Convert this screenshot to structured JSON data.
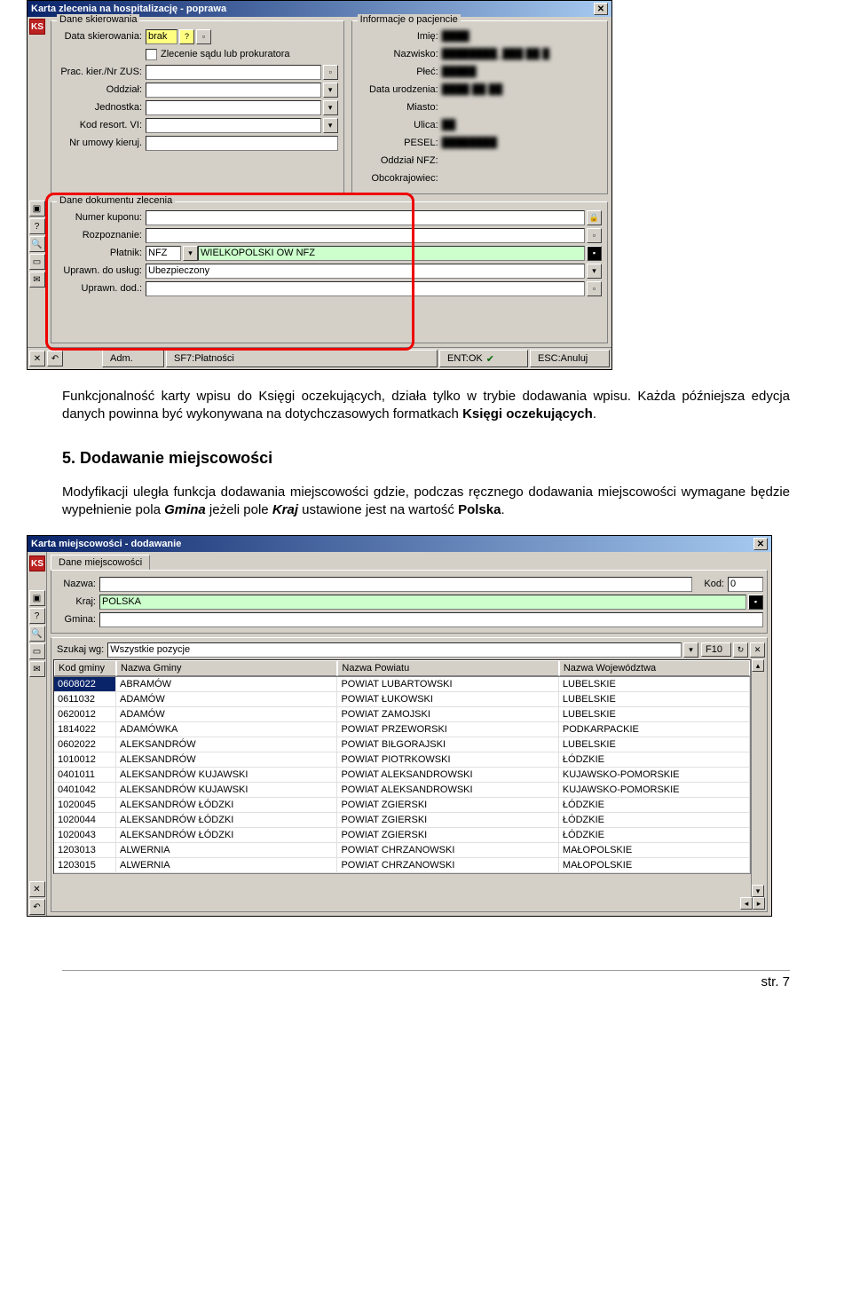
{
  "window1": {
    "title": "Karta zlecenia na hospitalizację - poprawa",
    "group_referral": "Dane skierowania",
    "group_patient": "Informacje o pacjencie",
    "ref": {
      "data_label": "Data skierowania:",
      "data_value": "brak",
      "zlecenie_checkbox_label": "Zlecenie sądu lub prokuratora",
      "prac_label": "Prac. kier./Nr ZUS:",
      "oddzial_label": "Oddział:",
      "jednostka_label": "Jednostka:",
      "kod_label": "Kod resort. VI:",
      "nr_umowy_label": "Nr umowy kieruj."
    },
    "patient": {
      "imie_label": "Imię:",
      "nazwisko_label": "Nazwisko:",
      "plec_label": "Płeć:",
      "data_ur_label": "Data urodzenia:",
      "miasto_label": "Miasto:",
      "ulica_label": "Ulica:",
      "pesel_label": "PESEL:",
      "nfz_label": "Oddział NFZ:",
      "obco_label": "Obcokrajowiec:"
    },
    "group_doc": "Dane dokumentu zlecenia",
    "doc": {
      "kupon_label": "Numer kuponu:",
      "rozpoznanie_label": "Rozpoznanie:",
      "platnik_label": "Płatnik:",
      "platnik_code": "NFZ",
      "platnik_value": "WIELKOPOLSKI OW NFZ",
      "uprawn_label": "Uprawn. do usług:",
      "uprawn_value": "Ubezpieczony",
      "uprawn_dod_label": "Uprawn. dod.:"
    },
    "bottom": {
      "adm": "Adm.",
      "sf7": "SF7:Płatności",
      "ent": "ENT:OK",
      "esc": "ESC:Anuluj"
    }
  },
  "text": {
    "para1a": "Funkcjonalność karty wpisu do Księgi oczekujących, działa tylko w trybie dodawania wpisu. Każda późniejsza edycja danych powinna być wykonywana na dotychczasowych formatkach ",
    "para1b": "Księgi oczekujących",
    "para1c": ".",
    "heading": "5. Dodawanie miejscowości",
    "para2a": "Modyfikacji uległa funkcja dodawania miejscowości gdzie, podczas ręcznego dodawania miejscowości wymagane będzie wypełnienie pola ",
    "para2b": "Gmina",
    "para2c": " jeżeli pole ",
    "para2d": "Kraj",
    "para2e": " ustawione jest na wartość ",
    "para2f": "Polska",
    "para2g": "."
  },
  "window2": {
    "title": "Karta miejscowości - dodawanie",
    "tab": "Dane miejscowości",
    "nazwa_label": "Nazwa:",
    "kod_label": "Kod:",
    "kod_value": "0",
    "kraj_label": "Kraj:",
    "kraj_value": "POLSKA",
    "gmina_label": "Gmina:",
    "szukaj_label": "Szukaj wg:",
    "szukaj_value": "Wszystkie pozycje",
    "f10": "F10",
    "cols": {
      "c0": "Kod gminy",
      "c1": "Nazwa Gminy",
      "c2": "Nazwa Powiatu",
      "c3": "Nazwa Województwa"
    },
    "rows": [
      {
        "c0": "0608022",
        "c1": "ABRAMÓW",
        "c2": "POWIAT LUBARTOWSKI",
        "c3": "LUBELSKIE"
      },
      {
        "c0": "0611032",
        "c1": "ADAMÓW",
        "c2": "POWIAT ŁUKOWSKI",
        "c3": "LUBELSKIE"
      },
      {
        "c0": "0620012",
        "c1": "ADAMÓW",
        "c2": "POWIAT ZAMOJSKI",
        "c3": "LUBELSKIE"
      },
      {
        "c0": "1814022",
        "c1": "ADAMÓWKA",
        "c2": "POWIAT PRZEWORSKI",
        "c3": "PODKARPACKIE"
      },
      {
        "c0": "0602022",
        "c1": "ALEKSANDRÓW",
        "c2": "POWIAT BIŁGORAJSKI",
        "c3": "LUBELSKIE"
      },
      {
        "c0": "1010012",
        "c1": "ALEKSANDRÓW",
        "c2": "POWIAT PIOTRKOWSKI",
        "c3": "ŁÓDZKIE"
      },
      {
        "c0": "0401011",
        "c1": "ALEKSANDRÓW KUJAWSKI",
        "c2": "POWIAT ALEKSANDROWSKI",
        "c3": "KUJAWSKO-POMORSKIE"
      },
      {
        "c0": "0401042",
        "c1": "ALEKSANDRÓW KUJAWSKI",
        "c2": "POWIAT ALEKSANDROWSKI",
        "c3": "KUJAWSKO-POMORSKIE"
      },
      {
        "c0": "1020045",
        "c1": "ALEKSANDRÓW ŁÓDZKI",
        "c2": "POWIAT ZGIERSKI",
        "c3": "ŁÓDZKIE"
      },
      {
        "c0": "1020044",
        "c1": "ALEKSANDRÓW ŁÓDZKI",
        "c2": "POWIAT ZGIERSKI",
        "c3": "ŁÓDZKIE"
      },
      {
        "c0": "1020043",
        "c1": "ALEKSANDRÓW ŁÓDZKI",
        "c2": "POWIAT ZGIERSKI",
        "c3": "ŁÓDZKIE"
      },
      {
        "c0": "1203013",
        "c1": "ALWERNIA",
        "c2": "POWIAT CHRZANOWSKI",
        "c3": "MAŁOPOLSKIE"
      },
      {
        "c0": "1203015",
        "c1": "ALWERNIA",
        "c2": "POWIAT CHRZANOWSKI",
        "c3": "MAŁOPOLSKIE"
      }
    ]
  },
  "footer": "str. 7"
}
